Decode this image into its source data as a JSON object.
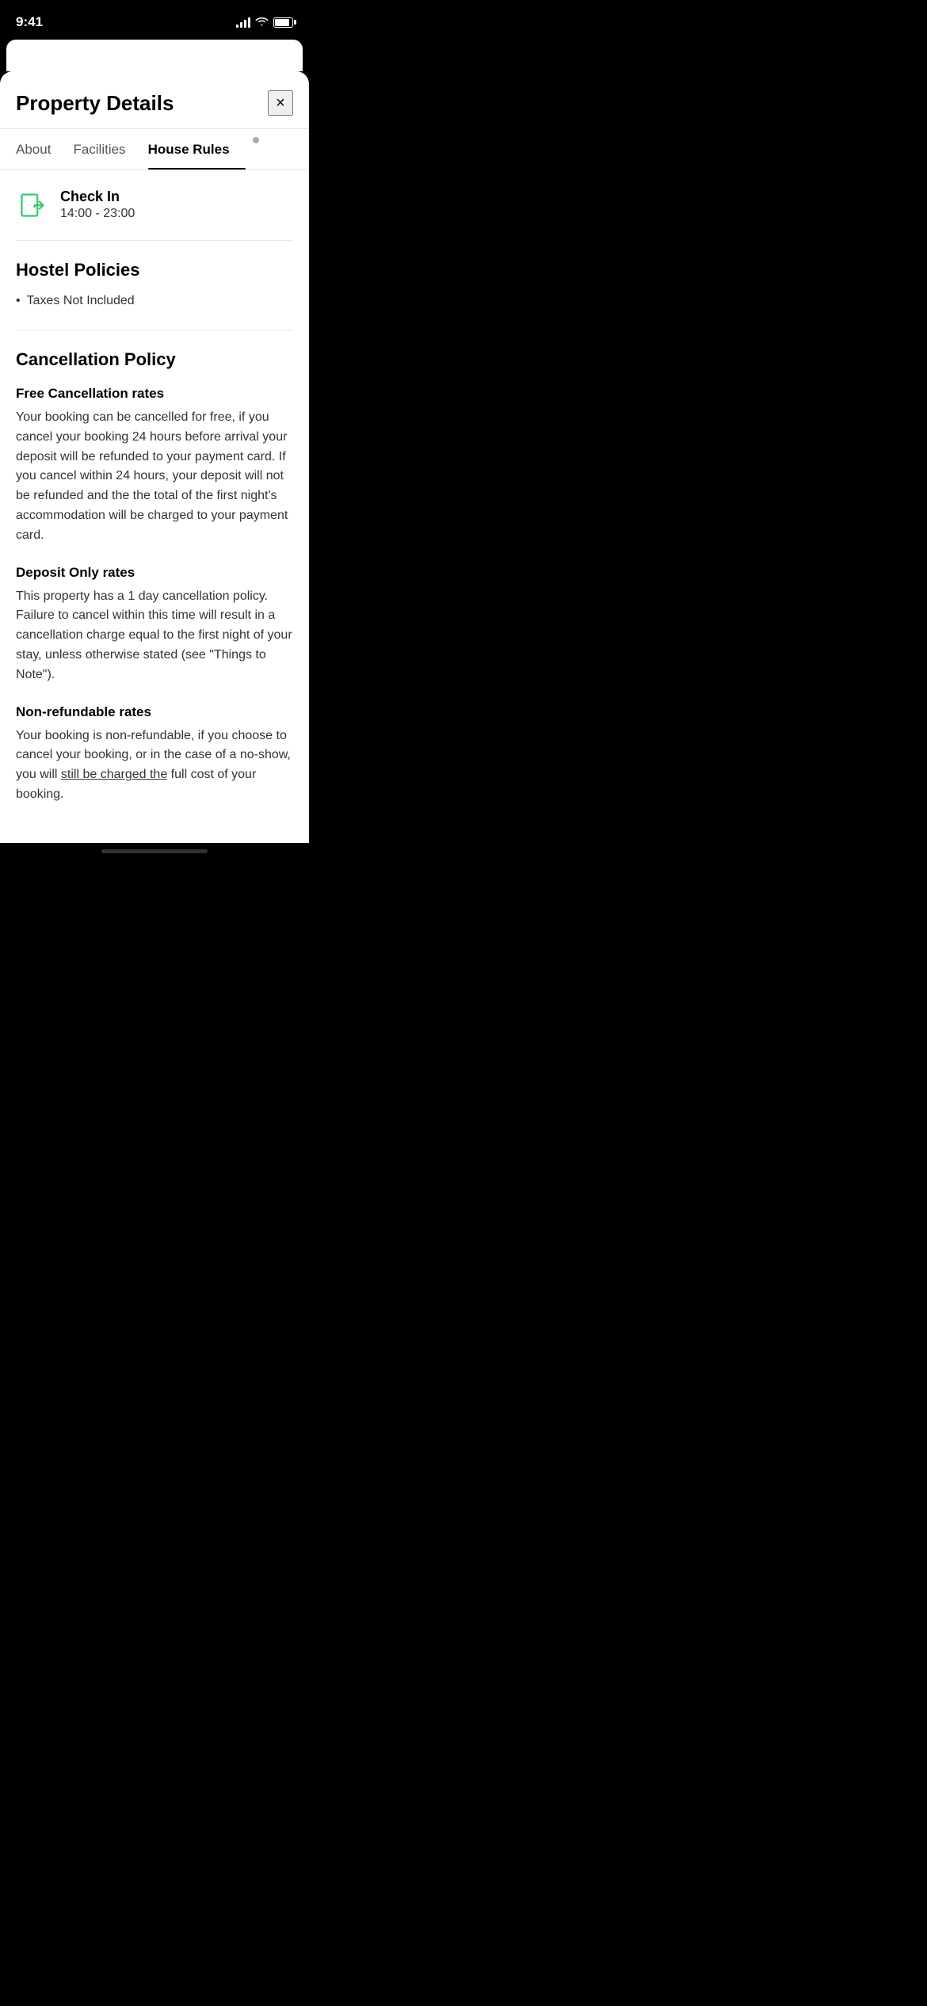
{
  "statusBar": {
    "time": "9:41"
  },
  "modal": {
    "title": "Property Details",
    "closeLabel": "×"
  },
  "tabs": [
    {
      "id": "about",
      "label": "About",
      "active": false
    },
    {
      "id": "facilities",
      "label": "Facilities",
      "active": false
    },
    {
      "id": "house-rules",
      "label": "House Rules",
      "active": true
    }
  ],
  "checkIn": {
    "label": "Check In",
    "time": "14:00 - 23:00"
  },
  "hostelPolicies": {
    "title": "Hostel Policies",
    "items": [
      "Taxes Not Included"
    ]
  },
  "cancellationPolicy": {
    "title": "Cancellation Policy",
    "subsections": [
      {
        "title": "Free Cancellation rates",
        "text": "Your booking can be cancelled for free, if you cancel your booking 24 hours before arrival your deposit will be refunded to your payment card.  If you cancel within 24 hours, your deposit will not be refunded and the the total of the first night's accommodation will be charged to your payment card."
      },
      {
        "title": "Deposit Only rates",
        "text": "This property has a 1 day cancellation policy. Failure to cancel within this time will result in a cancellation charge equal to the first night of your stay, unless otherwise stated (see \"Things to Note\")."
      },
      {
        "title": "Non-refundable rates",
        "text": "Your booking is non-refundable, if you choose to cancel your booking, or in the case of a no-show, you will still be charged the full cost of your booking."
      }
    ]
  }
}
